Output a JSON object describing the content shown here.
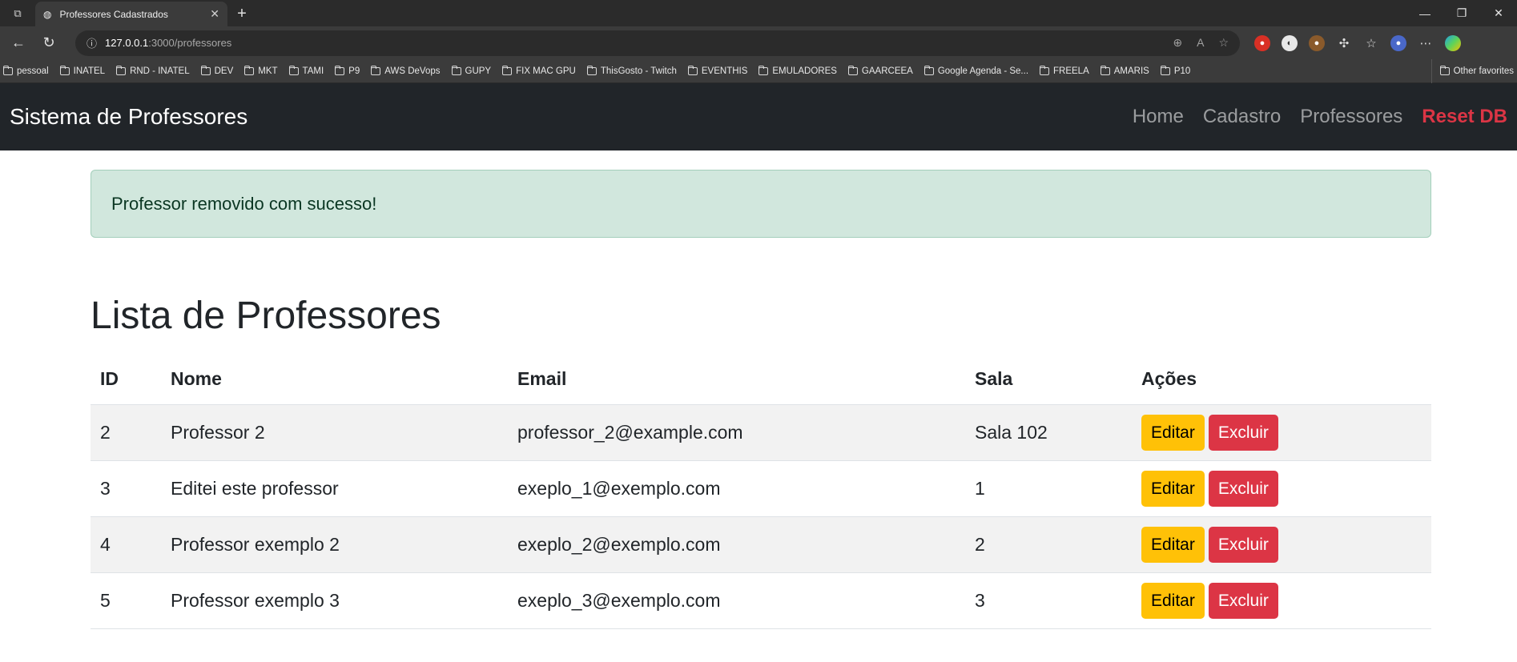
{
  "browser": {
    "tab_title": "Professores Cadastrados",
    "url_host": "127.0.0.1",
    "url_path": ":3000/professores",
    "bookmarks": [
      "pessoal",
      "INATEL",
      "RND - INATEL",
      "DEV",
      "MKT",
      "TAMI",
      "P9",
      "AWS DeVops",
      "GUPY",
      "FIX MAC GPU",
      "ThisGosto - Twitch",
      "EVENTHIS",
      "EMULADORES",
      "GAARCEEA",
      "Google Agenda - Se...",
      "FREELA",
      "AMARIS",
      "P10"
    ],
    "bookmarks_other": "Other favorites"
  },
  "navbar": {
    "brand": "Sistema de Professores",
    "links": [
      "Home",
      "Cadastro",
      "Professores"
    ],
    "reset": "Reset DB"
  },
  "alert": "Professor removido com sucesso!",
  "page_title": "Lista de Professores",
  "table": {
    "headers": [
      "ID",
      "Nome",
      "Email",
      "Sala",
      "Ações"
    ],
    "rows": [
      {
        "id": "2",
        "nome": "Professor 2",
        "email": "professor_2@example.com",
        "sala": "Sala 102"
      },
      {
        "id": "3",
        "nome": "Editei este professor",
        "email": "exeplo_1@exemplo.com",
        "sala": "1"
      },
      {
        "id": "4",
        "nome": "Professor exemplo 2",
        "email": "exeplo_2@exemplo.com",
        "sala": "2"
      },
      {
        "id": "5",
        "nome": "Professor exemplo 3",
        "email": "exeplo_3@exemplo.com",
        "sala": "3"
      }
    ],
    "edit_label": "Editar",
    "delete_label": "Excluir"
  },
  "colors": {
    "navbar_bg": "#212529",
    "alert_bg": "#d1e7dd",
    "edit": "#ffc107",
    "delete": "#dc3545",
    "reset": "#dc3545"
  }
}
